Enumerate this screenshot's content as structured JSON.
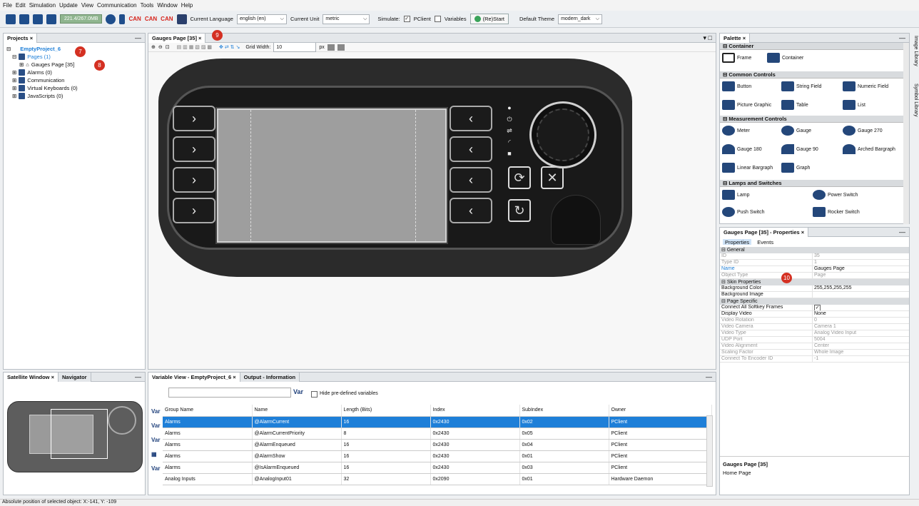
{
  "menu": [
    "File",
    "Edit",
    "Simulation",
    "Update",
    "View",
    "Communication",
    "Tools",
    "Window",
    "Help"
  ],
  "toolbar": {
    "memory": "221.4/267.0MB",
    "can_labels": [
      "CAN",
      "CAN",
      "CAN"
    ],
    "current_language_label": "Current Language",
    "current_language_value": "english (en)",
    "current_unit_label": "Current Unit",
    "current_unit_value": "metric",
    "simulate_label": "Simulate:",
    "pclient_label": "PClient",
    "pclient_checked": true,
    "variables_label": "Variables",
    "restart_label": "(Re)Start",
    "default_theme_label": "Default Theme",
    "default_theme_value": "modern_dark"
  },
  "projects": {
    "tab": "Projects",
    "root": "EmptyProject_6",
    "items": [
      "Pages (1)",
      "Gauges Page [35]",
      "Alarms (0)",
      "Communication",
      "Virtual Keyboards (0)",
      "JavaScripts (0)"
    ]
  },
  "editor": {
    "tab": "Gauges Page [35]",
    "grid_width_label": "Grid Width:",
    "grid_width_value": "10",
    "px_label": "px"
  },
  "badges": [
    "7",
    "8",
    "9",
    "10"
  ],
  "satellite": {
    "tab1": "Satellite Window",
    "tab2": "Navigator"
  },
  "bottom": {
    "tab1": "Variable View - EmptyProject_6",
    "tab2": "Output - Information",
    "hide_label": "Hide pre-defined variables",
    "var_label": "Var",
    "columns": [
      "Group Name",
      "Name",
      "Length (Bits)",
      "Index",
      "SubIndex",
      "Owner"
    ],
    "rows": [
      [
        "Alarms",
        "@AlarmCurrent",
        "16",
        "0x2430",
        "0x02",
        "PClient"
      ],
      [
        "Alarms",
        "@AlarmCurrentPriority",
        "8",
        "0x2430",
        "0x05",
        "PClient"
      ],
      [
        "Alarms",
        "@AlarmEnqueued",
        "16",
        "0x2430",
        "0x04",
        "PClient"
      ],
      [
        "Alarms",
        "@AlarmShow",
        "16",
        "0x2430",
        "0x01",
        "PClient"
      ],
      [
        "Alarms",
        "@IsAlarmEnqueued",
        "16",
        "0x2430",
        "0x03",
        "PClient"
      ],
      [
        "Analog Inputs",
        "@AnalogInput01",
        "32",
        "0x2090",
        "0x01",
        "Hardware Daemon"
      ]
    ]
  },
  "palette": {
    "tab": "Palette",
    "side_tabs": [
      "Image Library",
      "Symbol Library"
    ],
    "sections": [
      {
        "title": "Container",
        "items": [
          "Frame",
          "Container"
        ]
      },
      {
        "title": "Common Controls",
        "items": [
          "Button",
          "String Field",
          "Numeric Field",
          "Picture Graphic",
          "Table",
          "List"
        ]
      },
      {
        "title": "Measurement Controls",
        "items": [
          "Meter",
          "Gauge",
          "Gauge 270",
          "Gauge 180",
          "Gauge 90",
          "Arched Bargraph",
          "Linear Bargraph",
          "Graph"
        ]
      },
      {
        "title": "Lamps and Switches",
        "items": [
          "Lamp",
          "Power Switch",
          "Push Switch",
          "Rocker Switch"
        ]
      }
    ]
  },
  "properties": {
    "tab": "Gauges Page [35] - Properties",
    "subtabs": [
      "Properties",
      "Events"
    ],
    "general": "General",
    "rows_general": [
      [
        "ID",
        "35"
      ],
      [
        "Type ID",
        "1"
      ],
      [
        "Name",
        "Gauges Page"
      ],
      [
        "Object Type",
        "Page"
      ]
    ],
    "skin": "Skin Properties",
    "rows_skin": [
      [
        "Background Color",
        "255,255,255,255"
      ],
      [
        "Background Image",
        ""
      ]
    ],
    "page": "Page Specific",
    "rows_page": [
      [
        "Connect All Softkey Frames",
        ""
      ],
      [
        "Display Video",
        "None"
      ],
      [
        "Video Rotation",
        "0"
      ],
      [
        "Video Camera",
        "Camera 1"
      ],
      [
        "Video Type",
        "Analog Video Input"
      ],
      [
        "UDP Port",
        "5004"
      ],
      [
        "Video Alignment",
        "Center"
      ],
      [
        "Scaling Factor",
        "Whole Image"
      ],
      [
        "Connect To Encoder ID",
        "-1"
      ]
    ],
    "info_title": "Gauges Page [35]",
    "info_desc": "Home Page"
  },
  "status": "Absolute position of selected object: X:-141, Y: -109"
}
